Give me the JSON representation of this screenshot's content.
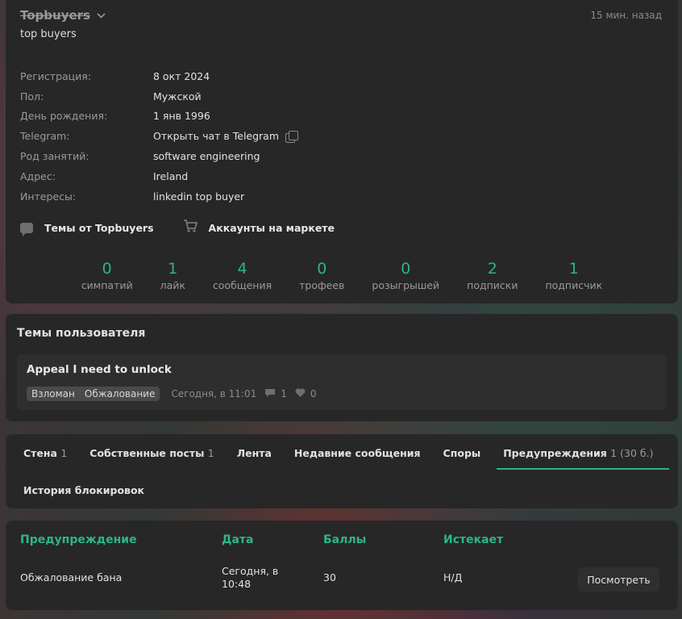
{
  "profile": {
    "username": "Topbuyers",
    "last_seen": "15 мин. назад",
    "subtitle": "top buyers",
    "info": [
      {
        "label": "Регистрация:",
        "value": "8 окт 2024"
      },
      {
        "label": "Пол:",
        "value": "Мужской"
      },
      {
        "label": "День рождения:",
        "value": "1 янв 1996"
      },
      {
        "label": "Telegram:",
        "value": "Открыть чат в Telegram"
      },
      {
        "label": "Род занятий:",
        "value": "software engineering"
      },
      {
        "label": "Адрес:",
        "value": "Ireland"
      },
      {
        "label": "Интересы:",
        "value": "linkedin top buyer"
      }
    ],
    "links": {
      "topics": "Темы от Topbuyers",
      "market": "Аккаунты на маркете"
    },
    "stats": [
      {
        "num": "0",
        "label": "симпатий"
      },
      {
        "num": "1",
        "label": "лайк"
      },
      {
        "num": "4",
        "label": "сообщения"
      },
      {
        "num": "0",
        "label": "трофеев"
      },
      {
        "num": "0",
        "label": "розыгрышей"
      },
      {
        "num": "2",
        "label": "подписки"
      },
      {
        "num": "1",
        "label": "подписчик"
      }
    ]
  },
  "topics": {
    "title": "Темы пользователя",
    "thread": {
      "title": "Appeal I need to unlock",
      "tags": [
        "Взломан",
        "Обжалование"
      ],
      "time": "Сегодня, в 11:01",
      "comments": "1",
      "likes": "0"
    }
  },
  "tabs": [
    {
      "label": "Стена",
      "count": "1"
    },
    {
      "label": "Собственные посты",
      "count": "1"
    },
    {
      "label": "Лента",
      "count": ""
    },
    {
      "label": "Недавние сообщения",
      "count": ""
    },
    {
      "label": "Споры",
      "count": ""
    },
    {
      "label": "Предупреждения",
      "count": "1 (30 б.)"
    },
    {
      "label": "История блокировок",
      "count": ""
    }
  ],
  "warnings": {
    "headers": [
      "Предупреждение",
      "Дата",
      "Баллы",
      "Истекает"
    ],
    "row": {
      "warning": "Обжалование бана",
      "date_line1": "Сегодня, в",
      "date_line2": "10:48",
      "points": "30",
      "expires": "Н/Д",
      "action": "Посмотреть"
    }
  },
  "colors": {
    "accent": "#2bb58a",
    "card": "#272727"
  }
}
